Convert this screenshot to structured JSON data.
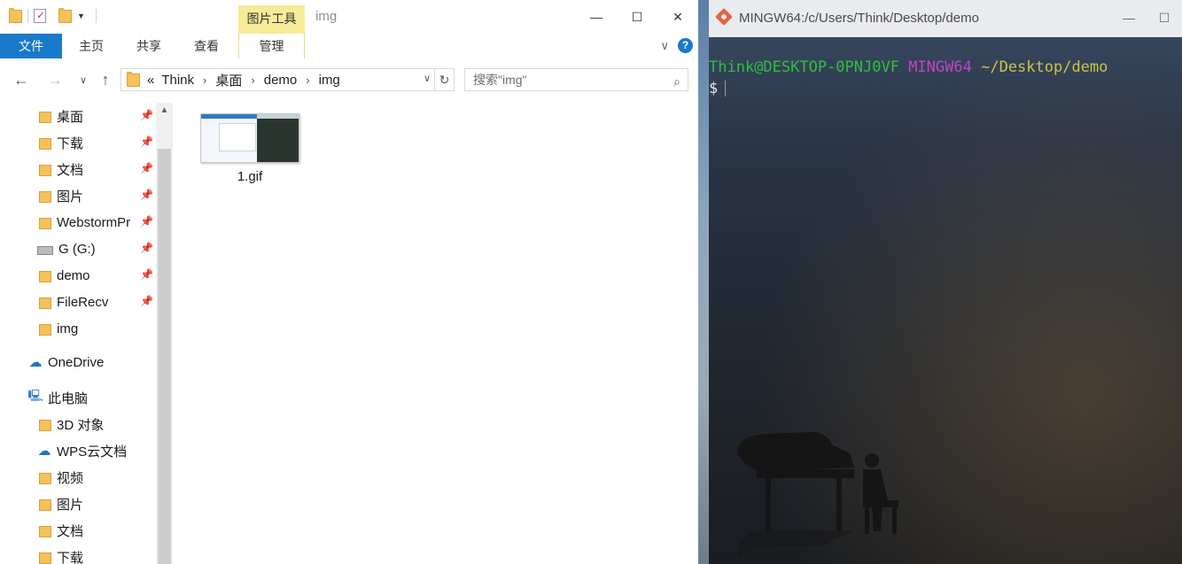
{
  "explorer": {
    "window_title": "img",
    "contextual_tab_group": "图片工具",
    "ribbon_tabs": [
      {
        "label": "文件"
      },
      {
        "label": "主页"
      },
      {
        "label": "共享"
      },
      {
        "label": "查看"
      },
      {
        "label": "管理"
      }
    ],
    "address": {
      "overflow": "«",
      "crumbs": [
        "Think",
        "桌面",
        "demo",
        "img"
      ]
    },
    "search_placeholder": "搜索\"img\"",
    "nav_items": [
      {
        "label": "桌面",
        "icon": "desktop-folder-icon",
        "pinned": true
      },
      {
        "label": "下载",
        "icon": "download-folder-icon",
        "pinned": true
      },
      {
        "label": "文档",
        "icon": "documents-folder-icon",
        "pinned": true
      },
      {
        "label": "图片",
        "icon": "pictures-folder-icon",
        "pinned": true
      },
      {
        "label": "WebstormPr",
        "icon": "folder-icon",
        "pinned": true
      },
      {
        "label": "G (G:)",
        "icon": "drive-icon",
        "pinned": true
      },
      {
        "label": "demo",
        "icon": "folder-icon",
        "pinned": true
      },
      {
        "label": "FileRecv",
        "icon": "folder-icon",
        "pinned": true
      },
      {
        "label": "img",
        "icon": "folder-icon",
        "pinned": false
      },
      {
        "label": "OneDrive",
        "icon": "onedrive-icon",
        "pinned": false
      },
      {
        "label": "此电脑",
        "icon": "this-pc-icon",
        "pinned": false
      },
      {
        "label": "3D 对象",
        "icon": "3d-objects-folder-icon",
        "pinned": false
      },
      {
        "label": "WPS云文档",
        "icon": "wps-cloud-icon",
        "pinned": false
      },
      {
        "label": "视频",
        "icon": "videos-folder-icon",
        "pinned": false
      },
      {
        "label": "图片",
        "icon": "pictures-folder-icon",
        "pinned": false
      },
      {
        "label": "文档",
        "icon": "documents-folder-icon",
        "pinned": false
      },
      {
        "label": "下载",
        "icon": "download-folder-icon",
        "pinned": false
      }
    ],
    "files": [
      {
        "name": "1.gif"
      }
    ]
  },
  "terminal": {
    "window_title": "MINGW64:/c/Users/Think/Desktop/demo",
    "prompt_user": "Think@DESKTOP-0PNJ0VF",
    "prompt_env": "MINGW64",
    "prompt_path": "~/Desktop/demo",
    "prompt_symbol": "$"
  },
  "colors": {
    "explorer_accent": "#1979ca",
    "contextual_tab": "#f7eb97",
    "terminal_user": "#2fbf3d",
    "terminal_env": "#c044c8",
    "terminal_path": "#cfc246"
  }
}
